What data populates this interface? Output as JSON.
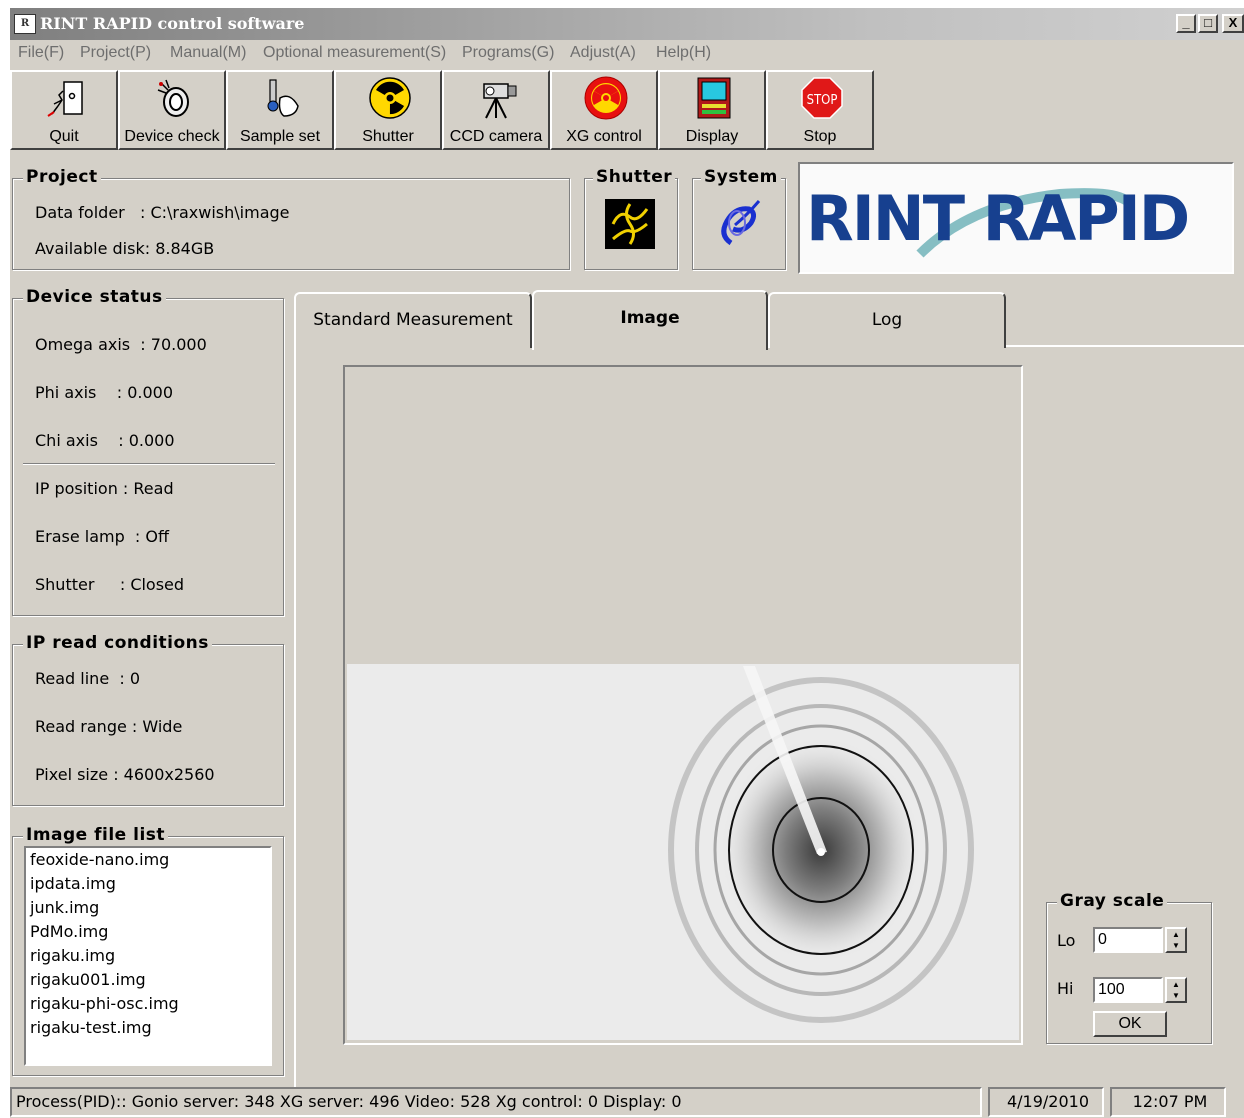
{
  "window": {
    "title": "RINT RAPID control software",
    "app_icon": "rint-app-icon",
    "controls": {
      "minimize": "_",
      "maximize": "□",
      "close": "X"
    }
  },
  "menu": [
    "File(F)",
    "Project(P)",
    "Manual(M)",
    "Optional measurement(S)",
    "Programs(G)",
    "Adjust(A)",
    "Help(H)"
  ],
  "toolbar": [
    {
      "label": "Quit",
      "icon": "quit-door-icon"
    },
    {
      "label": "Device check",
      "icon": "device-check-icon"
    },
    {
      "label": "Sample set",
      "icon": "sample-set-icon"
    },
    {
      "label": "Shutter",
      "icon": "radiation-icon"
    },
    {
      "label": "CCD camera",
      "icon": "ccd-camera-icon"
    },
    {
      "label": "XG control",
      "icon": "xg-radiation-icon"
    },
    {
      "label": "Display",
      "icon": "display-monitor-icon"
    },
    {
      "label": "Stop",
      "icon": "stop-sign-icon",
      "sign_text": "STOP"
    }
  ],
  "project": {
    "title": "Project",
    "data_folder": "Data folder   : C:\\raxwish\\image",
    "available_disk": "Available disk: 8.84GB"
  },
  "shutter_panel": {
    "title": "Shutter",
    "icon": "shutter-icon"
  },
  "system_panel": {
    "title": "System",
    "icon": "system-icon"
  },
  "logo": {
    "text": "RINT RAPID",
    "color": "#17408f"
  },
  "device_status": {
    "title": "Device status",
    "omega": "Omega axis  : 70.000",
    "phi": "Phi axis    : 0.000",
    "chi": "Chi axis    : 0.000",
    "ip_position": "IP position : Read",
    "erase_lamp": "Erase lamp  : Off",
    "shutter": "Shutter     : Closed"
  },
  "ip_read": {
    "title": "IP read conditions",
    "read_line": "Read line  : 0",
    "read_range": "Read range : Wide",
    "pixel_size": "Pixel size : 4600x2560"
  },
  "image_files": {
    "title": "Image file list",
    "items": [
      "feoxide-nano.img",
      "ipdata.img",
      "junk.img",
      "PdMo.img",
      "rigaku.img",
      "rigaku001.img",
      "rigaku-phi-osc.img",
      "rigaku-test.img"
    ]
  },
  "tabs": [
    {
      "label": "Standard Measurement",
      "active": false
    },
    {
      "label": "Image",
      "active": true
    },
    {
      "label": "Log",
      "active": false
    }
  ],
  "gray_scale": {
    "title": "Gray scale",
    "lo_label": "Lo",
    "lo_value": "0",
    "hi_label": "Hi",
    "hi_value": "100",
    "ok_label": "OK"
  },
  "status_bar": {
    "process": "Process(PID):: Gonio server: 348  XG server: 496  Video: 528  Xg control: 0  Display: 0",
    "date": "4/19/2010",
    "time": "12:07 PM"
  }
}
